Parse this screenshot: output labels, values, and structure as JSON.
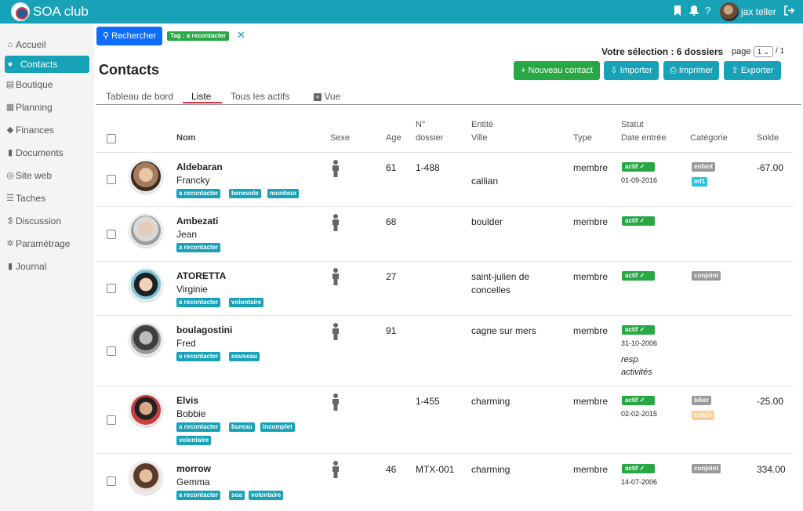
{
  "app": {
    "title": "SOA club",
    "user": "jax teller"
  },
  "sidebar": {
    "items": [
      {
        "label": "Accueil",
        "icon": "home-icon"
      },
      {
        "label": "Contacts",
        "icon": "users-icon",
        "active": true
      },
      {
        "label": "Boutique",
        "icon": "store-icon"
      },
      {
        "label": "Planning",
        "icon": "calendar-icon"
      },
      {
        "label": "Finances",
        "icon": "piggy-bank-icon"
      },
      {
        "label": "Documents",
        "icon": "file-icon"
      },
      {
        "label": "Site web",
        "icon": "globe-icon"
      },
      {
        "label": "Taches",
        "icon": "list-icon"
      },
      {
        "label": "Discussion",
        "icon": "dollar-circle-icon"
      },
      {
        "label": "Paramétrage",
        "icon": "gear-icon"
      },
      {
        "label": "Journal",
        "icon": "book-icon"
      }
    ]
  },
  "search": {
    "button_label": "Rechercher",
    "tag_filter": "Tag : a recontacter"
  },
  "selection": {
    "text": "Votre sélection : 6 dossiers",
    "page_label": "page",
    "page_value": "1",
    "page_total": "/ 1"
  },
  "page_title": "Contacts",
  "actions": {
    "new_contact": "Nouveau contact",
    "import": "Importer",
    "print": "Imprimer",
    "export": "Exporter"
  },
  "tabs": [
    {
      "label": "Tableau de bord"
    },
    {
      "label": "Liste",
      "active": true
    },
    {
      "label": "Tous les actifs"
    },
    {
      "label": "Vue"
    }
  ],
  "table": {
    "columns": {
      "nom": "Nom",
      "sexe": "Sexe",
      "age": "Age",
      "dossier_1": "N°",
      "dossier_2": "dossier",
      "entite": "Entité",
      "ville": "Ville",
      "type": "Type",
      "statut": "Statut",
      "date_entree": "Date entrée",
      "categorie": "Catégorie",
      "solde": "Solde"
    },
    "rows": [
      {
        "nom": "Aldebaran",
        "prenom": "Francky",
        "tags": [
          "a recontacter",
          "benevole",
          "moniteur"
        ],
        "tags2": [],
        "age": "61",
        "dossier": "1-488",
        "ville": "callian",
        "ville2": "",
        "type": "membre",
        "statut": "actif ✓",
        "date": "01-09-2016",
        "note": "",
        "note2": "",
        "cats": [
          "enfant",
          "mf1"
        ],
        "solde": "-67.00"
      },
      {
        "nom": "Ambezati",
        "prenom": "Jean",
        "tags": [
          "a recontacter"
        ],
        "tags2": [],
        "age": "68",
        "dossier": "",
        "ville": "boulder",
        "ville2": "",
        "type": "membre",
        "statut": "actif ✓",
        "date": "",
        "note": "",
        "note2": "",
        "cats": [],
        "solde": ""
      },
      {
        "nom": "ATORETTA",
        "prenom": "Virginie",
        "tags": [
          "a recontacter",
          "volontaire"
        ],
        "tags2": [],
        "age": "27",
        "dossier": "",
        "ville": "saint-julien de",
        "ville2": "concelles",
        "type": "membre",
        "statut": "actif ✓",
        "date": "",
        "note": "",
        "note2": "",
        "cats": [
          "conjoint"
        ],
        "solde": ""
      },
      {
        "nom": "boulagostini",
        "prenom": "Fred",
        "tags": [
          "a recontacter",
          "nouveau"
        ],
        "tags2": [],
        "age": "91",
        "dossier": "",
        "ville": "cagne sur mers",
        "ville2": "",
        "type": "membre",
        "statut": "actif ✓",
        "date": "31-10-2006",
        "note": "resp.",
        "note2": "activités",
        "cats": [],
        "solde": ""
      },
      {
        "nom": "Elvis",
        "prenom": "Bobbie",
        "tags": [
          "a recontacter",
          "bureau",
          "incomplet"
        ],
        "tags2": [
          "volontaire"
        ],
        "age": "",
        "dossier": "1-455",
        "ville": "charming",
        "ville2": "",
        "type": "membre",
        "statut": "actif ✓",
        "date": "02-02-2015",
        "note": "",
        "note2": "",
        "cats": [
          "biker",
          "coach"
        ],
        "solde": "-25.00"
      },
      {
        "nom": "morrow",
        "prenom": "Gemma",
        "tags": [
          "a recontacter",
          "soa",
          "volontaire"
        ],
        "tags2": [],
        "age": "46",
        "dossier": "MTX-001",
        "ville": "charming",
        "ville2": "",
        "type": "membre",
        "statut": "actif ✓",
        "date": "14-07-2006",
        "note": "",
        "note2": "",
        "cats": [
          "conjoint"
        ],
        "solde": "334.00"
      }
    ]
  }
}
